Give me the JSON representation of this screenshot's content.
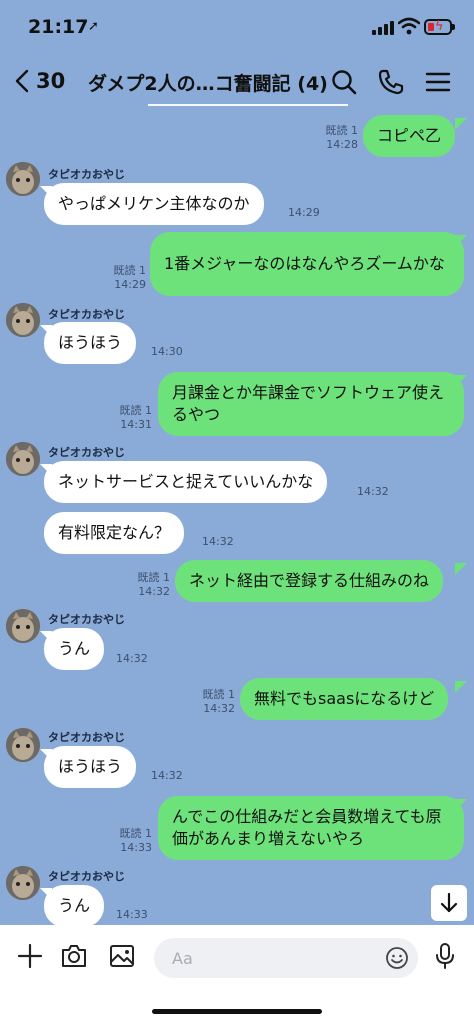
{
  "status_bar": {
    "time": "21:17"
  },
  "header": {
    "back_count": "30",
    "title": "ダメプ2人の…コ奮闘記 (4)"
  },
  "colors": {
    "chat_bg": "#8aabd8",
    "outgoing_bubble": "#6ee27a",
    "incoming_bubble": "#ffffff"
  },
  "messages": [
    {
      "dir": "out",
      "read": "既読 1",
      "time": "14:28",
      "text": "コピペ乙"
    },
    {
      "dir": "in",
      "sender": "タピオカおやじ",
      "time": "14:29",
      "text": "やっぱメリケン主体なのか"
    },
    {
      "dir": "out",
      "read": "既読 1",
      "time": "14:29",
      "text": "1番メジャーなのはなんやろズームかな"
    },
    {
      "dir": "in",
      "sender": "タピオカおやじ",
      "time": "14:30",
      "text": "ほうほう"
    },
    {
      "dir": "out",
      "read": "既読 1",
      "time": "14:31",
      "text": "月課金とか年課金でソフトウェア使えるやつ"
    },
    {
      "dir": "in",
      "sender": "タピオカおやじ",
      "time": "14:32",
      "text": "ネットサービスと捉えていいんかな"
    },
    {
      "dir": "in",
      "time": "14:32",
      "text": "有料限定なん？"
    },
    {
      "dir": "out",
      "read": "既読 1",
      "time": "14:32",
      "text": "ネット経由で登録する仕組みのね"
    },
    {
      "dir": "in",
      "sender": "タピオカおやじ",
      "time": "14:32",
      "text": "うん"
    },
    {
      "dir": "out",
      "read": "既読 1",
      "time": "14:32",
      "text": "無料でもsaasになるけど"
    },
    {
      "dir": "in",
      "sender": "タピオカおやじ",
      "time": "14:32",
      "text": "ほうほう"
    },
    {
      "dir": "out",
      "read": "既読 1",
      "time": "14:33",
      "text": "んでこの仕組みだと会員数増えても原価があんまり増えないやろ"
    },
    {
      "dir": "in",
      "sender": "タピオカおやじ",
      "time": "14:33",
      "text": "うん"
    }
  ],
  "input": {
    "placeholder": "Aa"
  },
  "icons": {
    "back": "chevron-left-icon",
    "search": "search-icon",
    "call": "phone-icon",
    "menu": "menu-icon",
    "plus": "plus-icon",
    "camera": "camera-icon",
    "image": "image-icon",
    "emoji": "emoji-icon",
    "mic": "microphone-icon",
    "scroll": "arrow-down-icon"
  }
}
